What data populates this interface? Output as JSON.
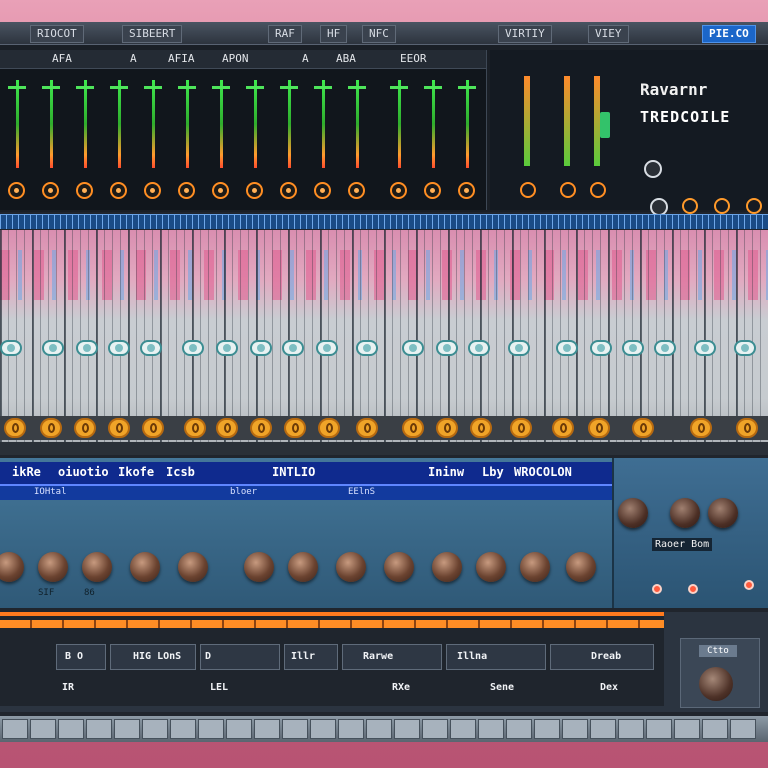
{
  "menubar": {
    "items": [
      "RIOCOT",
      "SIBEERT",
      "RAF",
      "HF",
      "NFC",
      "PIE.CO",
      "VIRTIY",
      "VIEY"
    ]
  },
  "mixer": {
    "header": [
      "AFA",
      "A",
      "AFIA",
      "APON",
      "A",
      "ABA",
      "EEOR"
    ]
  },
  "preset": {
    "line1": "Ravarnr",
    "line2": "TREDCOILE"
  },
  "fx": {
    "tabs": [
      "ikRe",
      "oiuotio",
      "Ikofe",
      "Icsb",
      "INTLIO",
      "Ininw",
      "Lby",
      "WROCOLON"
    ],
    "sub": [
      "IOHtal",
      "bloer",
      "EElnS"
    ],
    "side_label": "Raoer Bom",
    "knob_labels": [
      "SIF",
      "86"
    ]
  },
  "transport": {
    "cells": [
      "B O",
      "HIG LOnS",
      "D",
      "Illr",
      "Rarwe",
      "Illna",
      "Dreab"
    ],
    "side_button": "Ctto",
    "bottom_labels": [
      "IR",
      "LEL",
      "RXe",
      "Sene",
      "Dex"
    ]
  },
  "colors": {
    "accent_blue": "#1b66c9",
    "accent_orange": "#ff8e23",
    "meter_green": "#3ee84e",
    "frame_pink": "#c8627a"
  }
}
